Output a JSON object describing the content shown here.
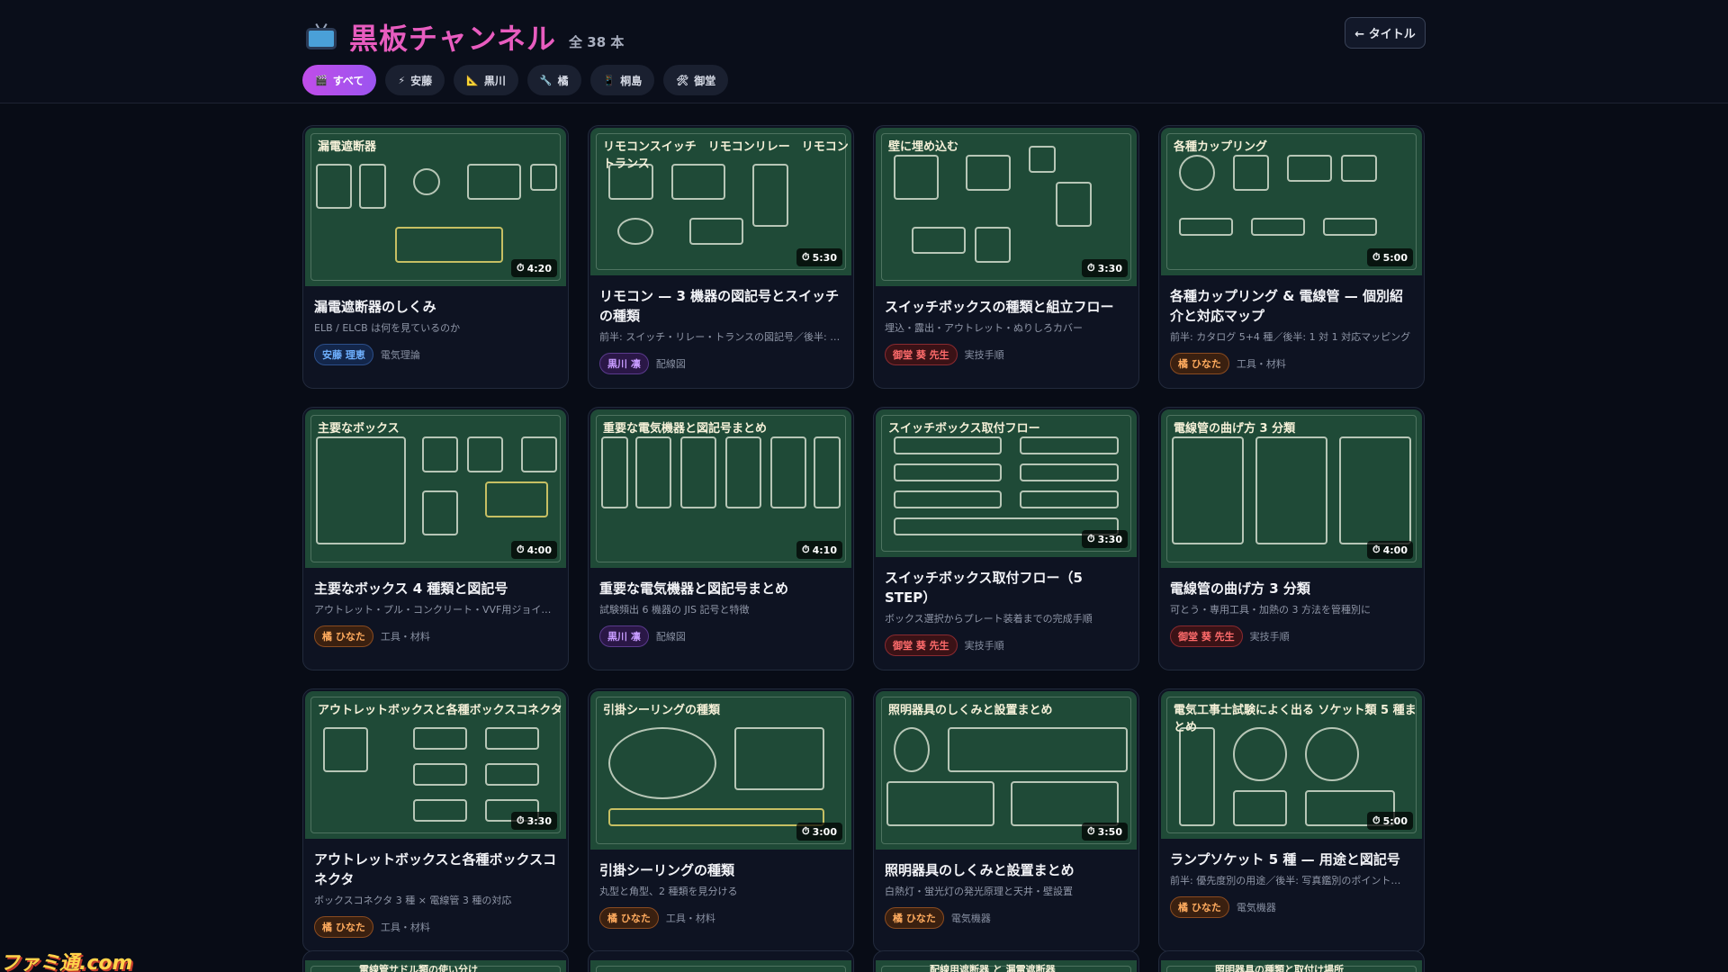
{
  "header": {
    "title": "黒板チャンネル",
    "count": "全 38 本",
    "back_label": "← タイトル"
  },
  "filters": [
    {
      "icon": "🎬",
      "label": "すべて"
    },
    {
      "icon": "⚡",
      "label": "安藤"
    },
    {
      "icon": "📐",
      "label": "黒川"
    },
    {
      "icon": "🔧",
      "label": "橘"
    },
    {
      "icon": "📱",
      "label": "桐島"
    },
    {
      "icon": "🛠",
      "label": "御堂"
    }
  ],
  "videos": [
    {
      "thumb_title": "漏電遮断器",
      "duration": "4:20",
      "title": "漏電遮断器のしくみ",
      "subtitle": "ELB / ELCB は何を見ているのか",
      "author": "安藤 理恵",
      "category": "電気理論"
    },
    {
      "thumb_title": "リモコンスイッチ　リモコンリレー　リモコントランス",
      "duration": "5:30",
      "title": "リモコン — 3 機器の図記号とスイッチの種類",
      "subtitle": "前半: スイッチ・リレー・トランスの図記号／後半: 操…",
      "author": "黒川 凛",
      "category": "配線図"
    },
    {
      "thumb_title": "壁に埋め込む",
      "duration": "3:30",
      "title": "スイッチボックスの種類と組立フロー",
      "subtitle": "埋込・露出・アウトレット・ぬりしろカバー",
      "author": "御堂 葵 先生",
      "category": "実技手順"
    },
    {
      "thumb_title": "各種カップリング",
      "duration": "5:00",
      "title": "各種カップリング & 電線管 — 個別紹介と対応マップ",
      "subtitle": "前半: カタログ 5+4 種／後半: 1 対 1 対応マッピング",
      "author": "橘 ひなた",
      "category": "工具・材料"
    },
    {
      "thumb_title": "主要なボックス",
      "duration": "4:00",
      "title": "主要なボックス 4 種類と図記号",
      "subtitle": "アウトレット・プル・コンクリート・VVF用ジョイント",
      "author": "橘 ひなた",
      "category": "工具・材料"
    },
    {
      "thumb_title": "重要な電気機器と図記号まとめ",
      "duration": "4:10",
      "title": "重要な電気機器と図記号まとめ",
      "subtitle": "試験頻出 6 機器の JIS 記号と特徴",
      "author": "黒川 凛",
      "category": "配線図"
    },
    {
      "thumb_title": "スイッチボックス取付フロー",
      "duration": "3:30",
      "title": "スイッチボックス取付フロー（5 STEP）",
      "subtitle": "ボックス選択からプレート装着までの完成手順",
      "author": "御堂 葵 先生",
      "category": "実技手順"
    },
    {
      "thumb_title": "電線管の曲げ方 3 分類",
      "duration": "4:00",
      "title": "電線管の曲げ方 3 分類",
      "subtitle": "可とう・専用工具・加熱の 3 方法を管種別に",
      "author": "御堂 葵 先生",
      "category": "実技手順"
    },
    {
      "thumb_title": "アウトレットボックスと各種ボックスコネクタ",
      "duration": "3:30",
      "title": "アウトレットボックスと各種ボックスコネクタ",
      "subtitle": "ボックスコネクタ 3 種 × 電線管 3 種の対応",
      "author": "橘 ひなた",
      "category": "工具・材料"
    },
    {
      "thumb_title": "引掛シーリングの種類",
      "duration": "3:00",
      "title": "引掛シーリングの種類",
      "subtitle": "丸型と角型、2 種類を見分ける",
      "author": "橘 ひなた",
      "category": "工具・材料"
    },
    {
      "thumb_title": "照明器具のしくみと設置まとめ",
      "duration": "3:50",
      "title": "照明器具のしくみと設置まとめ",
      "subtitle": "白熱灯・蛍光灯の発光原理と天井・壁設置",
      "author": "橘 ひなた",
      "category": "電気機器"
    },
    {
      "thumb_title": "電気工事士試験によく出る ソケット類 5 種まとめ",
      "duration": "5:00",
      "title": "ランプソケット 5 種 — 用途と図記号",
      "subtitle": "前半: 優先度別の用途／後半: 写真鑑別のポイント…",
      "author": "橘 ひなた",
      "category": "電気機器"
    }
  ],
  "peek_titles": [
    "電線管サドル類の使い分け",
    "",
    "配線用遮断器 と 漏電遮断器",
    "照明器具の種類と取付け場所"
  ],
  "watermark": "ファミ通.com"
}
